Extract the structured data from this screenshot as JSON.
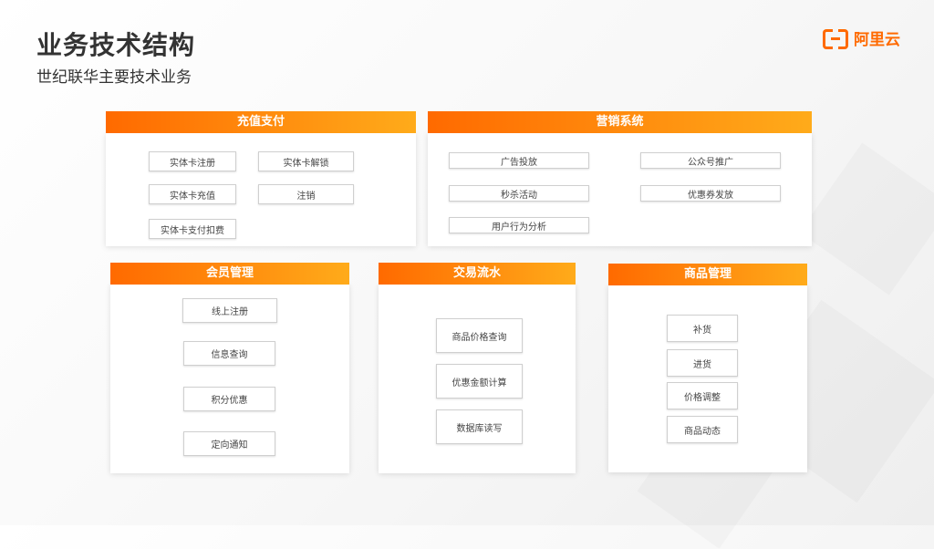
{
  "header": {
    "title": "业务技术结构",
    "subtitle": "世纪联华主要技术业务"
  },
  "logo": {
    "text": "阿里云",
    "icon": "aliyun-logo-icon"
  },
  "colors": {
    "accent": "#ff6a00",
    "accent_end": "#ffab1a"
  },
  "panels": {
    "recharge": {
      "title": "充值支付",
      "items": [
        "实体卡注册",
        "实体卡解锁",
        "实体卡充值",
        "注销",
        "实体卡支付扣费"
      ]
    },
    "marketing": {
      "title": "营销系统",
      "items": [
        "广告投放",
        "公众号推广",
        "秒杀活动",
        "优惠券发放",
        "用户行为分析"
      ]
    },
    "member": {
      "title": "会员管理",
      "items": [
        "线上注册",
        "信息查询",
        "积分优惠",
        "定向通知"
      ]
    },
    "trade": {
      "title": "交易流水",
      "items": [
        "商品价格查询",
        "优惠金额计算",
        "数据库读写"
      ]
    },
    "goods": {
      "title": "商品管理",
      "items": [
        "补货",
        "进货",
        "价格调整",
        "商品动态"
      ]
    }
  }
}
